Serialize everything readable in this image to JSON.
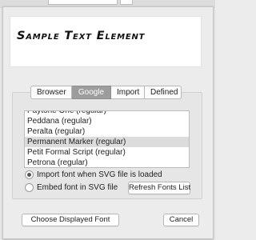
{
  "preview": {
    "text": "Sample Text Element"
  },
  "tabs": [
    {
      "label": "Browser",
      "active": false
    },
    {
      "label": "Google",
      "active": true
    },
    {
      "label": "Import",
      "active": false
    },
    {
      "label": "Defined",
      "active": false
    }
  ],
  "font_list": {
    "items": [
      "Paytone One (regular)",
      "Peddana (regular)",
      "Peralta (regular)",
      "Permanent Marker (regular)",
      "Petit Formal Script (regular)",
      "Petrona (regular)"
    ],
    "selected_index": 3
  },
  "options": {
    "import_label": "Import font when SVG file is loaded",
    "embed_label": "Embed font in SVG file",
    "selected": "import"
  },
  "buttons": {
    "refresh_label": "Refresh Fonts List",
    "choose_label": "Choose Displayed Font",
    "cancel_label": "Cancel"
  }
}
